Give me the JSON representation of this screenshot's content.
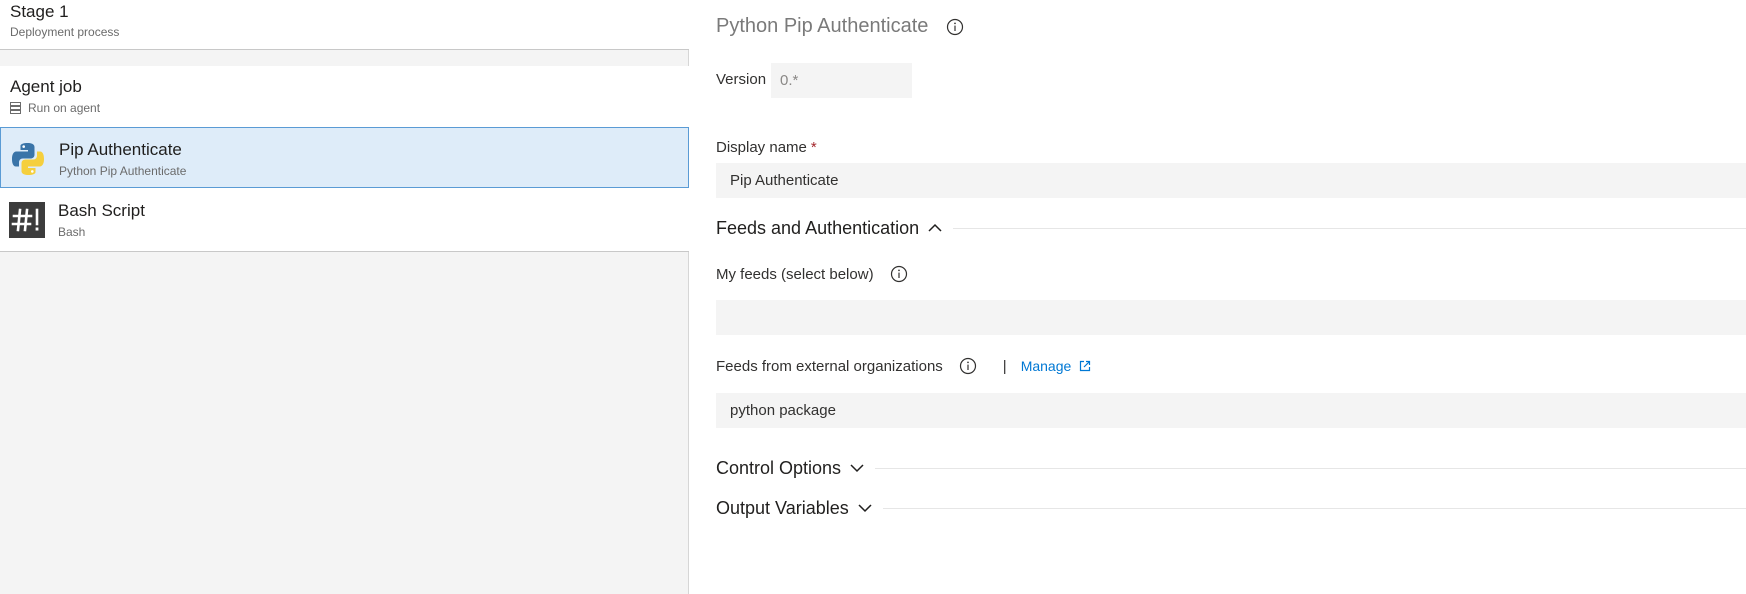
{
  "left_pane": {
    "stage": {
      "title": "Stage 1",
      "subtitle": "Deployment process"
    },
    "agent_job": {
      "title": "Agent job",
      "subtitle": "Run on agent",
      "icon": "server-icon"
    },
    "tasks": [
      {
        "title": "Pip Authenticate",
        "subtitle": "Python Pip Authenticate",
        "icon": "python-icon",
        "selected": true
      },
      {
        "title": "Bash Script",
        "subtitle": "Bash",
        "icon": "bash-icon",
        "selected": false
      }
    ]
  },
  "right_pane": {
    "heading": "Python Pip Authenticate",
    "version": {
      "label": "Version",
      "value": "0.*"
    },
    "display_name": {
      "label": "Display name",
      "required_mark": "*",
      "value": "Pip Authenticate"
    },
    "sections": {
      "feeds": "Feeds and Authentication",
      "control": "Control Options",
      "output": "Output Variables"
    },
    "my_feeds": {
      "label": "My feeds (select below)",
      "value": ""
    },
    "external_feeds": {
      "label": "Feeds from external organizations",
      "separator": "|",
      "manage_link": "Manage",
      "value": "python package"
    }
  },
  "colors": {
    "selected_bg": "#deecf9",
    "selected_border": "#5a9bd5",
    "link": "#0078d4",
    "required": "#a4262c"
  }
}
